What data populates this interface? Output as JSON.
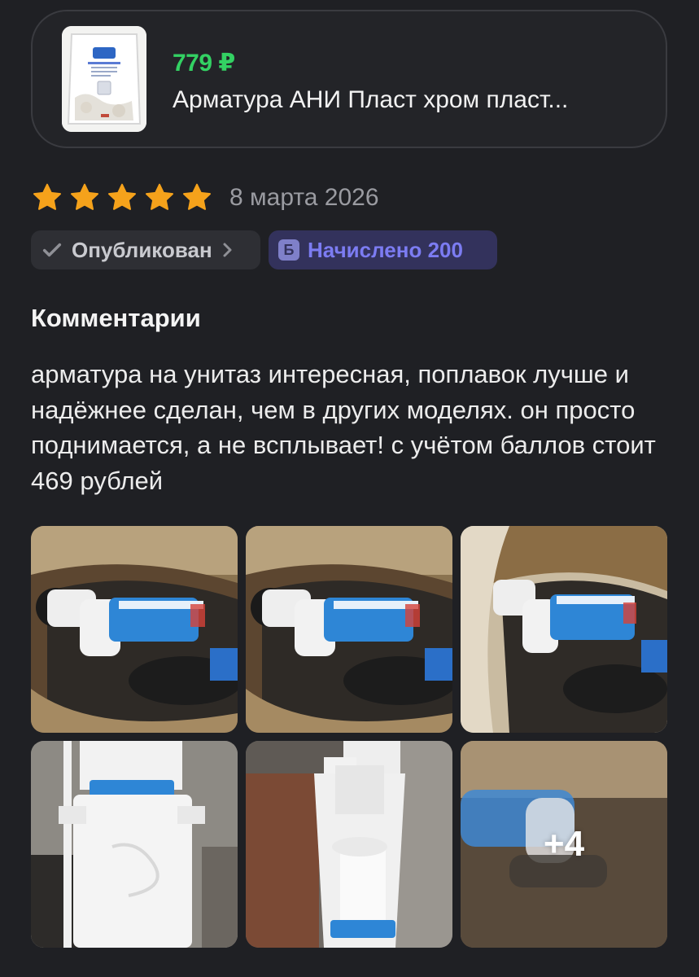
{
  "product": {
    "price": "779 ₽",
    "title": "Арматура АНИ Пласт хром пласт...",
    "price_color": "#33d163"
  },
  "review": {
    "rating": 5,
    "rating_max": 5,
    "star_color": "#f5a21b",
    "date": "8 марта 2026",
    "status_label": "Опубликован",
    "points_icon_letter": "Б",
    "points_label": "Начислено 200",
    "comments_title": "Комментарии",
    "comment": "арматура на унитаз интересная, поплавок лучше и надёжнее сделан, чем в других моделях. он просто поднимается, а не всплывает! с учётом баллов стоит 469 рублей"
  },
  "gallery": {
    "photos": [
      {
        "name": "photo-1"
      },
      {
        "name": "photo-2"
      },
      {
        "name": "photo-3"
      },
      {
        "name": "photo-4"
      },
      {
        "name": "photo-5"
      },
      {
        "name": "photo-6"
      }
    ],
    "more_label": "+4"
  },
  "icons": {
    "star": "star-icon",
    "check": "check-icon",
    "chevron": "chevron-right-icon",
    "points": "points-icon"
  }
}
